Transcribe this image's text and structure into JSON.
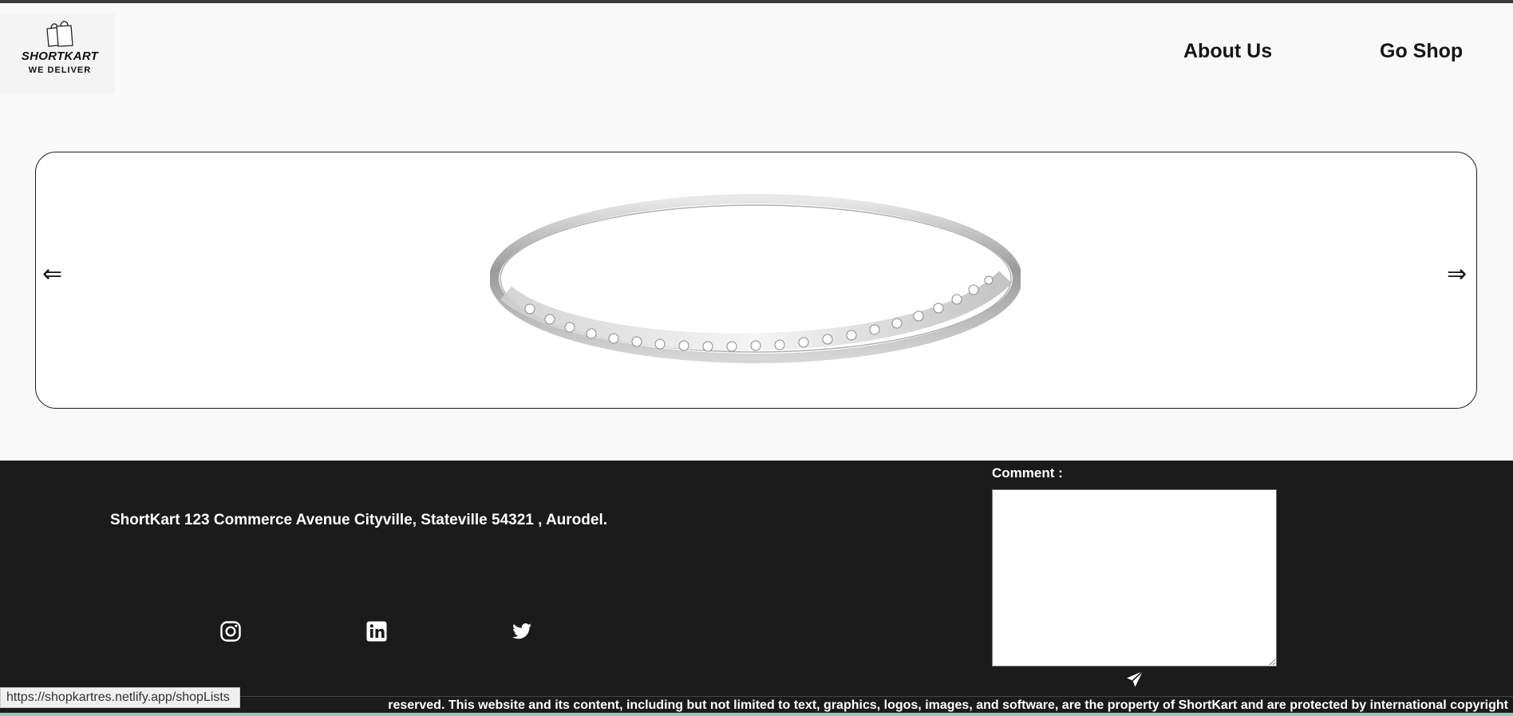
{
  "brand": {
    "name": "SHORTKART",
    "tagline": "WE DELIVER"
  },
  "nav": {
    "about": "About Us",
    "shop": "Go Shop"
  },
  "carousel": {
    "prev_arrow": "⇐",
    "next_arrow": "⇒",
    "slide_alt": "Silver ring with diamonds"
  },
  "footer": {
    "address": "ShortKart 123 Commerce Avenue Cityville, Stateville 54321 , Aurodel.",
    "social_icons": [
      "instagram-icon",
      "linkedin-icon",
      "twitter-icon"
    ],
    "comment_label": "Comment :",
    "comment_value": "",
    "send_icon": "send-icon",
    "copyright": "reserved. This website and its content, including but not limited to text, graphics, logos, images, and software, are the property of ShortKart and are protected by international copyright"
  },
  "status_url": "https://shopkartres.netlify.app/shopLists",
  "colors": {
    "footer_bg": "#1b1b1b",
    "page_bg": "#f8f9f8"
  }
}
